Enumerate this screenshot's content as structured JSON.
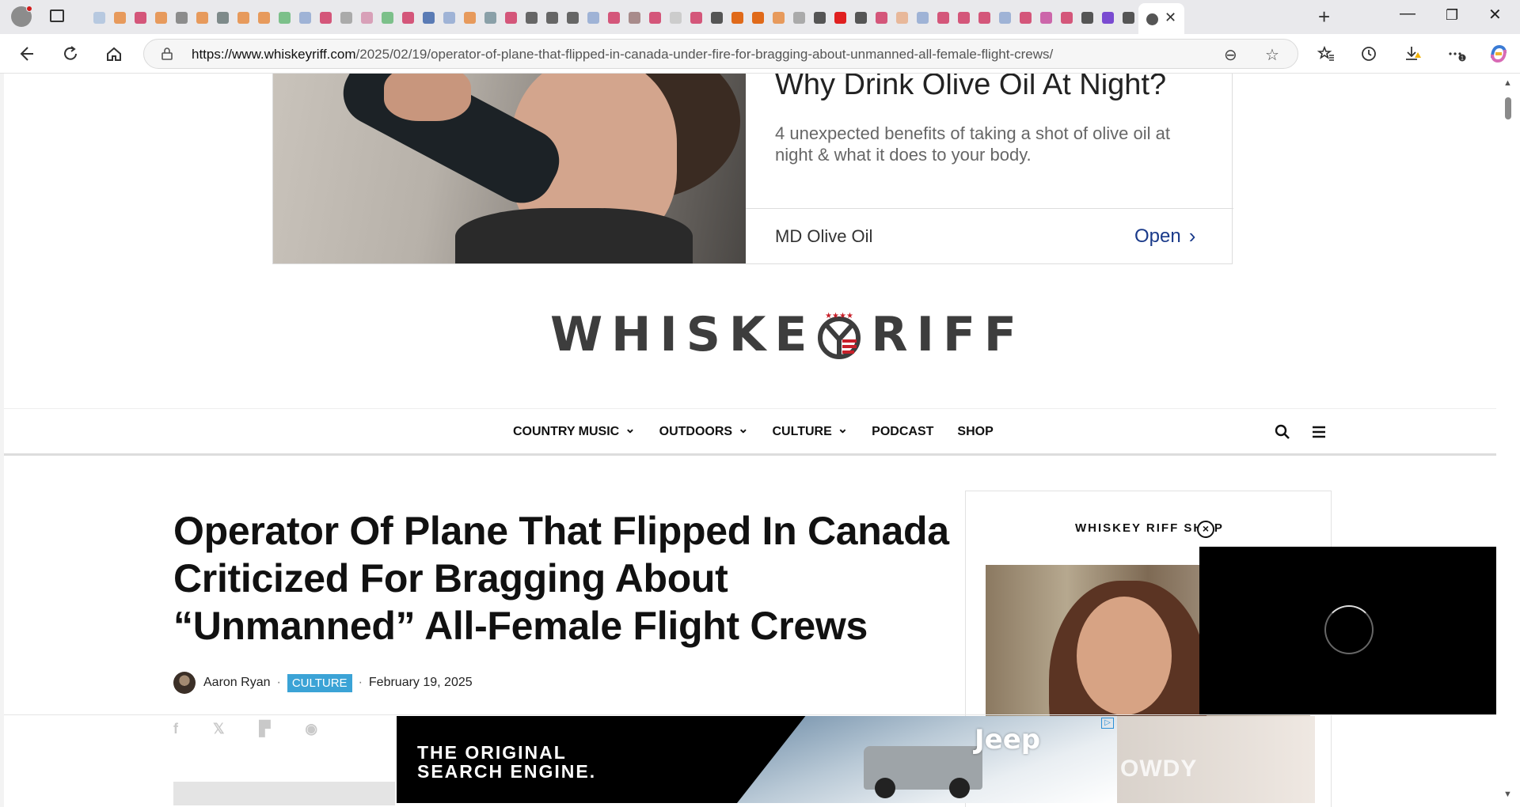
{
  "browser": {
    "url_host": "https://www.whiskeyriff.com",
    "url_path": "/2025/02/19/operator-of-plane-that-flipped-in-canada-under-fire-for-bragging-about-unmanned-all-female-flight-crews/",
    "tab_favicon_colors": [
      "#b7c9e0",
      "#e79a5c",
      "#d4567a",
      "#e79a5c",
      "#8c8c8c",
      "#e79a5c",
      "#7e8a8a",
      "#e79a5c",
      "#e79a5c",
      "#7cc08a",
      "#9fb3d6",
      "#d4567a",
      "#aaaaaa",
      "#d8a0b8",
      "#7cc08a",
      "#d4567a",
      "#5a7bb5",
      "#9fb3d6",
      "#e79a5c",
      "#8aa0a8",
      "#d4567a",
      "#666666",
      "#666666",
      "#666666",
      "#9fb3d6",
      "#d4567a",
      "#a88b8b",
      "#d4567a",
      "#cccccc",
      "#d4567a",
      "#555555",
      "#e06a1a",
      "#e06a1a",
      "#e79a5c",
      "#aaaaaa",
      "#555555",
      "#e02020",
      "#555555",
      "#d4567a",
      "#e8b89a",
      "#9fb3d6",
      "#d4567a",
      "#d4567a",
      "#d4567a",
      "#9fb3d6",
      "#d4567a",
      "#cc66aa",
      "#d4567a",
      "#555555",
      "#7a4bd1",
      "#555555"
    ],
    "icons": {
      "back": "arrow-left-icon",
      "refresh": "refresh-icon",
      "home": "home-icon",
      "favorites": "favorites-icon",
      "history": "history-icon",
      "downloads": "download-icon",
      "more": "more-icon",
      "copilot": "copilot-icon"
    }
  },
  "top_ad": {
    "headline": "Why Drink Olive Oil At Night?",
    "description": "4 unexpected benefits of taking a shot of olive oil at night & what it does to your body.",
    "advertiser": "MD Olive Oil",
    "cta": "Open",
    "cta_color": "#1a3a8a"
  },
  "site": {
    "logo_left": "WHISKE",
    "logo_right": "RIFF",
    "nav": [
      {
        "label": "COUNTRY MUSIC",
        "dropdown": true
      },
      {
        "label": "OUTDOORS",
        "dropdown": true
      },
      {
        "label": "CULTURE",
        "dropdown": true
      },
      {
        "label": "PODCAST",
        "dropdown": false
      },
      {
        "label": "SHOP",
        "dropdown": false
      }
    ]
  },
  "article": {
    "title": "Operator Of Plane That Flipped In Canada Criticized For Bragging About “Unmanned” All-Female Flight Crews",
    "author": "Aaron Ryan",
    "category": "CULTURE",
    "category_color": "#3ba3d6",
    "date": "February 19, 2025",
    "share_icons": [
      "facebook-icon",
      "x-icon",
      "flipboard-icon",
      "reddit-icon"
    ]
  },
  "sidebar": {
    "label": "WHISKEY RIFF SHOP"
  },
  "bottom_ad": {
    "tagline_line1": "THE ORIGINAL",
    "tagline_line2": "SEARCH ENGINE.",
    "brand": "Jeep",
    "right_ghost_text": "OWDY"
  }
}
